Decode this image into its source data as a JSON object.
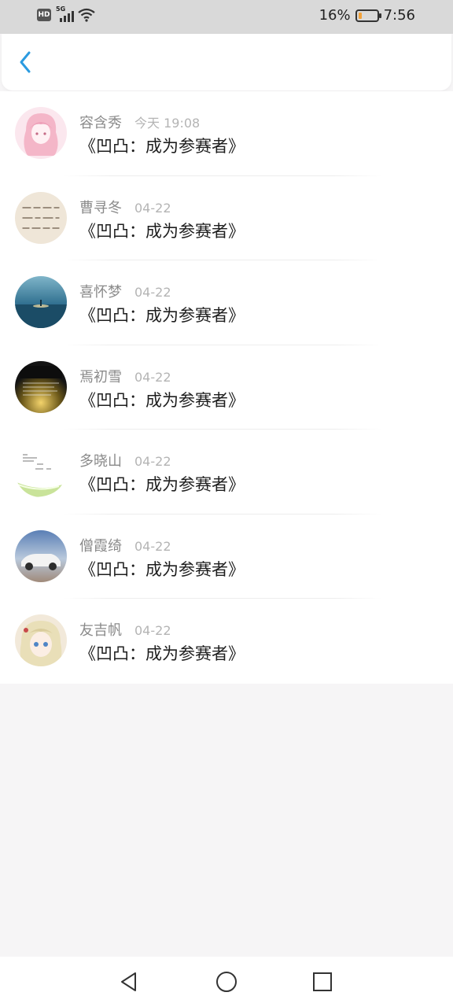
{
  "status_bar": {
    "hd_label": "HD",
    "network_label": "5G",
    "battery_percent": "16%",
    "battery_level": 0.16,
    "battery_color": "#f2a23a",
    "time": "7:56"
  },
  "header": {
    "back_icon": "chevron-left-icon",
    "accent_color": "#2b9be0"
  },
  "items": [
    {
      "name": "容含秀",
      "time": "今天 19:08",
      "title": "《凹凸：成为参赛者》",
      "avatar": "pink-anime-girl"
    },
    {
      "name": "曹寻冬",
      "time": "04-22",
      "title": "《凹凸：成为参赛者》",
      "avatar": "handwritten-text"
    },
    {
      "name": "喜怀梦",
      "time": "04-22",
      "title": "《凹凸：成为参赛者》",
      "avatar": "ocean-sunset"
    },
    {
      "name": "焉初雪",
      "time": "04-22",
      "title": "《凹凸：成为参赛者》",
      "avatar": "dark-text-珍惜"
    },
    {
      "name": "多晓山",
      "time": "04-22",
      "title": "《凹凸：成为参赛者》",
      "avatar": "lime-slice"
    },
    {
      "name": "僧霞绮",
      "time": "04-22",
      "title": "《凹凸：成为参赛者》",
      "avatar": "white-car"
    },
    {
      "name": "友吉帆",
      "time": "04-22",
      "title": "《凹凸：成为参赛者》",
      "avatar": "anime-blonde-girl"
    }
  ],
  "nav": {
    "back_icon": "triangle-back-icon",
    "home_icon": "circle-home-icon",
    "recents_icon": "square-recents-icon"
  }
}
